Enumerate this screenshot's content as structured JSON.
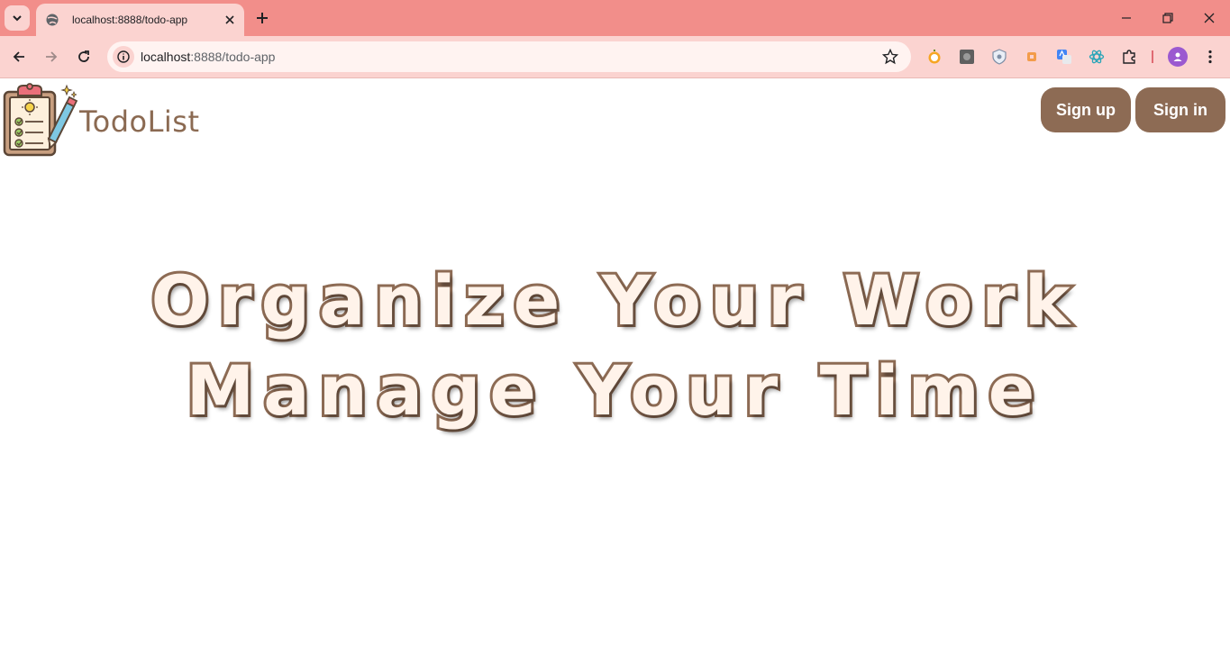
{
  "browser": {
    "tab_title": "localhost:8888/todo-app",
    "url_host": "localhost",
    "url_path": ":8888/todo-app",
    "icons": [
      "tab-list-icon",
      "globe-icon",
      "close-icon",
      "plus-icon",
      "minimize-icon",
      "restore-icon",
      "window-close-icon",
      "back-icon",
      "forward-icon",
      "reload-icon",
      "site-info-icon",
      "bookmark-star-icon",
      "extension-icon",
      "profile-icon",
      "menu-icon"
    ],
    "colors": {
      "tabbar": "#f28e8a",
      "toolbar": "#fbd3d0"
    }
  },
  "header": {
    "brand": "TodoList",
    "signup_label": "Sign up",
    "signin_label": "Sign in"
  },
  "hero": {
    "line1": "Organize Your Work",
    "line2": "Manage Your Time"
  },
  "colors": {
    "accent": "#8d6b54",
    "hero_fill": "#fff3ea"
  }
}
